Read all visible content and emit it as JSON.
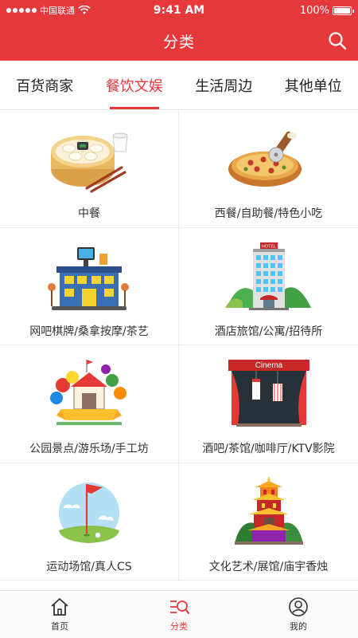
{
  "status": {
    "carrier": "中国联通",
    "time": "9:41 AM",
    "battery_text": "100%",
    "battery_level": 1.0
  },
  "nav": {
    "title": "分类",
    "search_icon": "search-icon"
  },
  "tabs": [
    {
      "label": "百货商家",
      "active": false
    },
    {
      "label": "餐饮文娱",
      "active": true
    },
    {
      "label": "生活周边",
      "active": false
    },
    {
      "label": "其他单位",
      "active": false
    }
  ],
  "categories": [
    {
      "label": "中餐",
      "icon": "dumplings-icon"
    },
    {
      "label": "西餐/自助餐/特色小吃",
      "icon": "pizza-icon"
    },
    {
      "label": "网吧棋牌/桑拿按摩/茶艺",
      "icon": "netcafe-building-icon"
    },
    {
      "label": "酒店旅馆/公寓/招待所",
      "icon": "hotel-icon"
    },
    {
      "label": "公园景点/游乐场/手工坊",
      "icon": "amusement-park-icon"
    },
    {
      "label": "酒吧/茶馆/咖啡厅/KTV影院",
      "icon": "cinema-icon"
    },
    {
      "label": "运动场馆/真人CS",
      "icon": "golf-flag-icon"
    },
    {
      "label": "文化艺术/展馆/庙宇香烛",
      "icon": "pagoda-icon"
    }
  ],
  "cinema_sign": "Cinema",
  "hotel_sign": "HOTEL",
  "tabbar": [
    {
      "label": "首页",
      "icon": "home-icon",
      "active": false
    },
    {
      "label": "分类",
      "icon": "category-icon",
      "active": true
    },
    {
      "label": "我的",
      "icon": "profile-icon",
      "active": false
    }
  ],
  "colors": {
    "brand": "#e5383b",
    "active_text": "#e5383b"
  }
}
